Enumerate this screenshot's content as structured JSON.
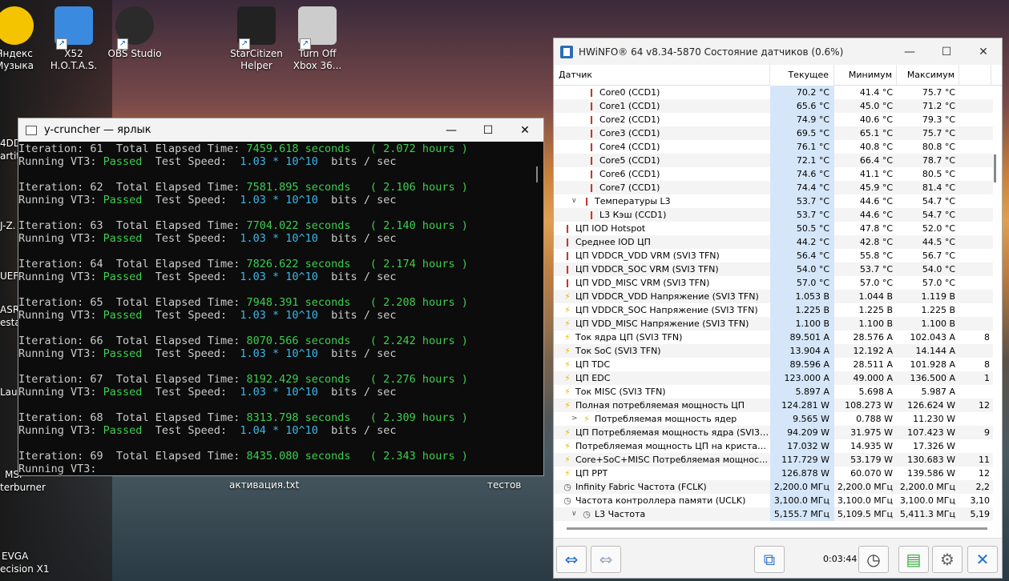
{
  "desktop": {
    "icons": [
      {
        "label": "Яндекс\nМузыка",
        "color": "#f5c400"
      },
      {
        "label": "X52\nH.O.T.A.S.",
        "color": "#3a8be0"
      },
      {
        "label": "OBS Studio",
        "color": "#2b2b2b"
      },
      {
        "label": "StarCitizen\nHelper",
        "color": "#222"
      },
      {
        "label": "Turn Off\nXbox 36...",
        "color": "#ccc"
      }
    ],
    "left_labels": [
      "4DD",
      "artit",
      "J-Z.",
      "UEF",
      "ASRo",
      "estar",
      "Lau",
      "MSI",
      "terburner",
      "EVGA",
      "ecision X1"
    ],
    "bottom_labels": [
      "активация.txt",
      "тестов"
    ]
  },
  "ycruncher": {
    "title": "y-cruncher — ярлык",
    "lines": [
      [
        "Iteration: ",
        "61",
        "  Total Elapsed Time: ",
        "7459.618 seconds",
        "   ( 2.072 hours )"
      ],
      [
        "Running VT3: ",
        "Passed",
        "  Test Speed:  ",
        "1.03 * 10^10",
        "  bits / sec"
      ],
      [
        "Iteration: ",
        "62",
        "  Total Elapsed Time: ",
        "7581.895 seconds",
        "   ( 2.106 hours )"
      ],
      [
        "Running VT3: ",
        "Passed",
        "  Test Speed:  ",
        "1.03 * 10^10",
        "  bits / sec"
      ],
      [
        "Iteration: ",
        "63",
        "  Total Elapsed Time: ",
        "7704.022 seconds",
        "   ( 2.140 hours )"
      ],
      [
        "Running VT3: ",
        "Passed",
        "  Test Speed:  ",
        "1.03 * 10^10",
        "  bits / sec"
      ],
      [
        "Iteration: ",
        "64",
        "  Total Elapsed Time: ",
        "7826.622 seconds",
        "   ( 2.174 hours )"
      ],
      [
        "Running VT3: ",
        "Passed",
        "  Test Speed:  ",
        "1.03 * 10^10",
        "  bits / sec"
      ],
      [
        "Iteration: ",
        "65",
        "  Total Elapsed Time: ",
        "7948.391 seconds",
        "   ( 2.208 hours )"
      ],
      [
        "Running VT3: ",
        "Passed",
        "  Test Speed:  ",
        "1.03 * 10^10",
        "  bits / sec"
      ],
      [
        "Iteration: ",
        "66",
        "  Total Elapsed Time: ",
        "8070.566 seconds",
        "   ( 2.242 hours )"
      ],
      [
        "Running VT3: ",
        "Passed",
        "  Test Speed:  ",
        "1.03 * 10^10",
        "  bits / sec"
      ],
      [
        "Iteration: ",
        "67",
        "  Total Elapsed Time: ",
        "8192.429 seconds",
        "   ( 2.276 hours )"
      ],
      [
        "Running VT3: ",
        "Passed",
        "  Test Speed:  ",
        "1.03 * 10^10",
        "  bits / sec"
      ],
      [
        "Iteration: ",
        "68",
        "  Total Elapsed Time: ",
        "8313.798 seconds",
        "   ( 2.309 hours )"
      ],
      [
        "Running VT3: ",
        "Passed",
        "  Test Speed:  ",
        "1.04 * 10^10",
        "  bits / sec"
      ],
      [
        "Iteration: ",
        "69",
        "  Total Elapsed Time: ",
        "8435.080 seconds",
        "   ( 2.343 hours )"
      ],
      [
        "Running VT3:",
        "",
        "",
        "",
        ""
      ]
    ]
  },
  "hwinfo": {
    "title": "HWiNFO® 64 v8.34-5870 Состояние датчиков (0.6%)",
    "columns": [
      "Датчик",
      "Текущее",
      "Минимум",
      "Максимум",
      ""
    ],
    "rows": [
      {
        "icon": "therm",
        "indent": 2,
        "name": "Core0 (CCD1)",
        "cur": "70.2 °C",
        "min": "41.4 °C",
        "max": "75.7 °C",
        "avg": ""
      },
      {
        "icon": "therm",
        "indent": 2,
        "name": "Core1 (CCD1)",
        "cur": "65.6 °C",
        "min": "45.0 °C",
        "max": "71.2 °C",
        "avg": ""
      },
      {
        "icon": "therm",
        "indent": 2,
        "name": "Core2 (CCD1)",
        "cur": "74.9 °C",
        "min": "40.6 °C",
        "max": "79.3 °C",
        "avg": ""
      },
      {
        "icon": "therm",
        "indent": 2,
        "name": "Core3 (CCD1)",
        "cur": "69.5 °C",
        "min": "65.1 °C",
        "max": "75.7 °C",
        "avg": ""
      },
      {
        "icon": "therm",
        "indent": 2,
        "name": "Core4 (CCD1)",
        "cur": "76.1 °C",
        "min": "40.8 °C",
        "max": "80.8 °C",
        "avg": ""
      },
      {
        "icon": "therm",
        "indent": 2,
        "name": "Core5 (CCD1)",
        "cur": "72.1 °C",
        "min": "66.4 °C",
        "max": "78.7 °C",
        "avg": ""
      },
      {
        "icon": "therm",
        "indent": 2,
        "name": "Core6 (CCD1)",
        "cur": "74.6 °C",
        "min": "41.1 °C",
        "max": "80.5 °C",
        "avg": ""
      },
      {
        "icon": "therm",
        "indent": 2,
        "name": "Core7 (CCD1)",
        "cur": "74.4 °C",
        "min": "45.9 °C",
        "max": "81.4 °C",
        "avg": ""
      },
      {
        "icon": "therm",
        "indent": 1,
        "exp": "∨",
        "name": "Температуры L3",
        "cur": "53.7 °C",
        "min": "44.6 °C",
        "max": "54.7 °C",
        "avg": ""
      },
      {
        "icon": "therm",
        "indent": 2,
        "name": "L3 Кэш (CCD1)",
        "cur": "53.7 °C",
        "min": "44.6 °C",
        "max": "54.7 °C",
        "avg": ""
      },
      {
        "icon": "therm",
        "indent": 0,
        "name": "ЦП IOD Hotspot",
        "cur": "50.5 °C",
        "min": "47.8 °C",
        "max": "52.0 °C",
        "avg": ""
      },
      {
        "icon": "therm",
        "indent": 0,
        "name": "Среднее IOD ЦП",
        "cur": "44.2 °C",
        "min": "42.8 °C",
        "max": "44.5 °C",
        "avg": ""
      },
      {
        "icon": "therm",
        "indent": 0,
        "name": "ЦП VDDCR_VDD VRM (SVI3 TFN)",
        "cur": "56.4 °C",
        "min": "55.8 °C",
        "max": "56.7 °C",
        "avg": ""
      },
      {
        "icon": "therm",
        "indent": 0,
        "name": "ЦП VDDCR_SOC VRM (SVI3 TFN)",
        "cur": "54.0 °C",
        "min": "53.7 °C",
        "max": "54.0 °C",
        "avg": ""
      },
      {
        "icon": "therm",
        "indent": 0,
        "name": "ЦП VDD_MISC VRM (SVI3 TFN)",
        "cur": "57.0 °C",
        "min": "57.0 °C",
        "max": "57.0 °C",
        "avg": ""
      },
      {
        "icon": "bolt",
        "indent": 0,
        "name": "ЦП VDDCR_VDD Напряжение (SVI3 TFN)",
        "cur": "1.053 В",
        "min": "1.044 В",
        "max": "1.119 В",
        "avg": ""
      },
      {
        "icon": "bolt",
        "indent": 0,
        "name": "ЦП VDDCR_SOC Напряжение (SVI3 TFN)",
        "cur": "1.225 В",
        "min": "1.225 В",
        "max": "1.225 В",
        "avg": ""
      },
      {
        "icon": "bolt",
        "indent": 0,
        "name": "ЦП VDD_MISC Напряжение (SVI3 TFN)",
        "cur": "1.100 В",
        "min": "1.100 В",
        "max": "1.100 В",
        "avg": ""
      },
      {
        "icon": "bolt",
        "indent": 0,
        "name": "Ток ядра ЦП (SVI3 TFN)",
        "cur": "89.501 A",
        "min": "28.576 A",
        "max": "102.043 A",
        "avg": "8"
      },
      {
        "icon": "bolt",
        "indent": 0,
        "name": "Ток SoC (SVI3 TFN)",
        "cur": "13.904 A",
        "min": "12.192 A",
        "max": "14.144 A",
        "avg": ""
      },
      {
        "icon": "bolt",
        "indent": 0,
        "name": "ЦП TDC",
        "cur": "89.596 A",
        "min": "28.511 A",
        "max": "101.928 A",
        "avg": "8"
      },
      {
        "icon": "bolt",
        "indent": 0,
        "name": "ЦП EDC",
        "cur": "123.000 A",
        "min": "49.000 A",
        "max": "136.500 A",
        "avg": "1"
      },
      {
        "icon": "bolt",
        "indent": 0,
        "name": "Ток MISC (SVI3 TFN)",
        "cur": "5.897 A",
        "min": "5.698 A",
        "max": "5.987 A",
        "avg": ""
      },
      {
        "icon": "bolt",
        "indent": 0,
        "name": "Полная потребляемая мощность ЦП",
        "cur": "124.281 W",
        "min": "108.273 W",
        "max": "126.624 W",
        "avg": "12"
      },
      {
        "icon": "bolt",
        "indent": 1,
        "exp": ">",
        "name": "Потребляемая мощность ядер",
        "cur": "9.565 W",
        "min": "0.788 W",
        "max": "11.230 W",
        "avg": ""
      },
      {
        "icon": "bolt",
        "indent": 0,
        "name": "ЦП Потребляемая мощность ядра (SVI3 T...",
        "cur": "94.209 W",
        "min": "31.975 W",
        "max": "107.423 W",
        "avg": "9"
      },
      {
        "icon": "bolt",
        "indent": 0,
        "name": "Потребляемая мощность ЦП на кристалл...",
        "cur": "17.032 W",
        "min": "14.935 W",
        "max": "17.326 W",
        "avg": ""
      },
      {
        "icon": "bolt",
        "indent": 0,
        "name": "Core+SoC+MISC Потребляемая мощность...",
        "cur": "117.729 W",
        "min": "53.179 W",
        "max": "130.683 W",
        "avg": "11"
      },
      {
        "icon": "bolt",
        "indent": 0,
        "name": "ЦП PPT",
        "cur": "126.878 W",
        "min": "60.070 W",
        "max": "139.586 W",
        "avg": "12"
      },
      {
        "icon": "clock",
        "indent": 0,
        "name": "Infinity Fabric Частота (FCLK)",
        "cur": "2,200.0 МГц",
        "min": "2,200.0 МГц",
        "max": "2,200.0 МГц",
        "avg": "2,2"
      },
      {
        "icon": "clock",
        "indent": 0,
        "name": "Частота контроллера памяти (UCLK)",
        "cur": "3,100.0 МГц",
        "min": "3,100.0 МГц",
        "max": "3,100.0 МГц",
        "avg": "3,10"
      },
      {
        "icon": "clock",
        "indent": 1,
        "exp": "∨",
        "name": "L3 Частота",
        "cur": "5,155.7 МГц",
        "min": "5,109.5 МГц",
        "max": "5,411.3 МГц",
        "avg": "5,19"
      }
    ],
    "elapsed": "0:03:44"
  },
  "colors": {
    "terminal_green": "#3ccf4e",
    "terminal_cyan": "#3ab8e6",
    "current_col": "#d5e6f8"
  }
}
